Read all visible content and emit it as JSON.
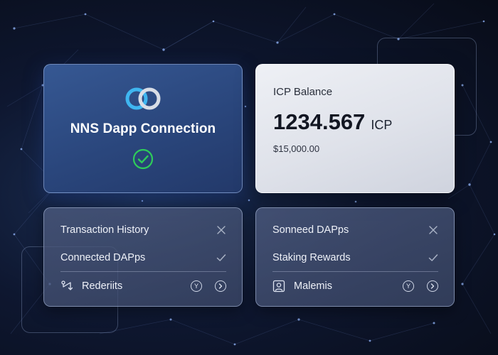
{
  "nns_card": {
    "title": "NNS Dapp Connection",
    "logo_icon": "infinity-rings-logo",
    "status_icon": "check-circle-icon",
    "accent_color": "#2ecc5a",
    "logo_colors": [
      "#3fb6f0",
      "#d8dde6"
    ]
  },
  "balance_card": {
    "label": "ICP Balance",
    "amount": "1234.567",
    "unit": "ICP",
    "fiat_value": "$15,000.00"
  },
  "left_list": {
    "items": [
      {
        "label": "Transaction History",
        "action_icon": "close-icon"
      },
      {
        "label": "Connected DAPps",
        "action_icon": "check-icon"
      }
    ],
    "footer": {
      "label": "Rederiits",
      "lead_icon": "route-icon",
      "badge_text": "Y",
      "next_icon": "chevron-right-icon"
    }
  },
  "right_list": {
    "items": [
      {
        "label": "Sonneed DAPps",
        "action_icon": "close-icon"
      },
      {
        "label": "Staking Rewards",
        "action_icon": "check-icon"
      }
    ],
    "footer": {
      "label": "Malemis",
      "lead_icon": "user-frame-icon",
      "badge_text": "Y",
      "next_icon": "chevron-right-icon"
    }
  }
}
